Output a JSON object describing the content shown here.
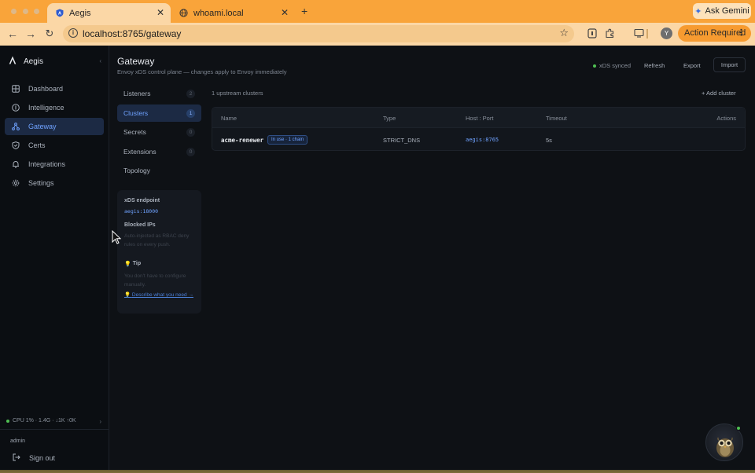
{
  "browser": {
    "tabs": [
      {
        "title": "Aegis",
        "active": true
      },
      {
        "title": "whoami.local",
        "active": false
      }
    ],
    "gemini_label": "Ask Gemini",
    "url": "localhost:8765/gateway",
    "profile_initial": "Y",
    "action_required": "Action Required"
  },
  "app": {
    "brand": "Aegis",
    "nav": [
      {
        "label": "Dashboard",
        "icon": "grid-icon"
      },
      {
        "label": "Intelligence",
        "icon": "bulb-icon"
      },
      {
        "label": "Gateway",
        "icon": "network-icon",
        "active": true
      },
      {
        "label": "Certs",
        "icon": "shield-icon"
      },
      {
        "label": "Integrations",
        "icon": "bell-icon"
      },
      {
        "label": "Settings",
        "icon": "gear-icon"
      }
    ],
    "cpu_status": "CPU 1% · 1.4G · ↓1K ↑0K",
    "user": "admin",
    "sign_out": "Sign out"
  },
  "header": {
    "title": "Gateway",
    "subtitle": "Envoy xDS control plane — changes apply to Envoy immediately",
    "sync_status": "xDS synced",
    "refresh": "Refresh",
    "export": "Export",
    "import": "Import"
  },
  "subnav": [
    {
      "label": "Listeners",
      "count": "2"
    },
    {
      "label": "Clusters",
      "count": "1",
      "active": true
    },
    {
      "label": "Secrets",
      "count": "0"
    },
    {
      "label": "Extensions",
      "count": "0"
    },
    {
      "label": "Topology",
      "count": ""
    }
  ],
  "info_card": {
    "xds_label": "xDS endpoint",
    "xds_value": "aegis:18000",
    "blocked_label": "Blocked IPs",
    "blocked_desc": "Auto-injected as RBAC deny rules on every push.",
    "tip_label": "Tip",
    "tip_text": "You don't have to configure manually.",
    "tip_link": "Describe what you need →"
  },
  "clusters": {
    "count_text": "1 upstream clusters",
    "add_label": "+ Add cluster",
    "columns": [
      "Name",
      "Type",
      "Host : Port",
      "Timeout",
      "Actions"
    ],
    "rows": [
      {
        "name": "acme-renewer",
        "badge": "In use · 1 chain",
        "type": "STRICT_DNS",
        "host": "aegis:8765",
        "timeout": "5s"
      }
    ]
  }
}
